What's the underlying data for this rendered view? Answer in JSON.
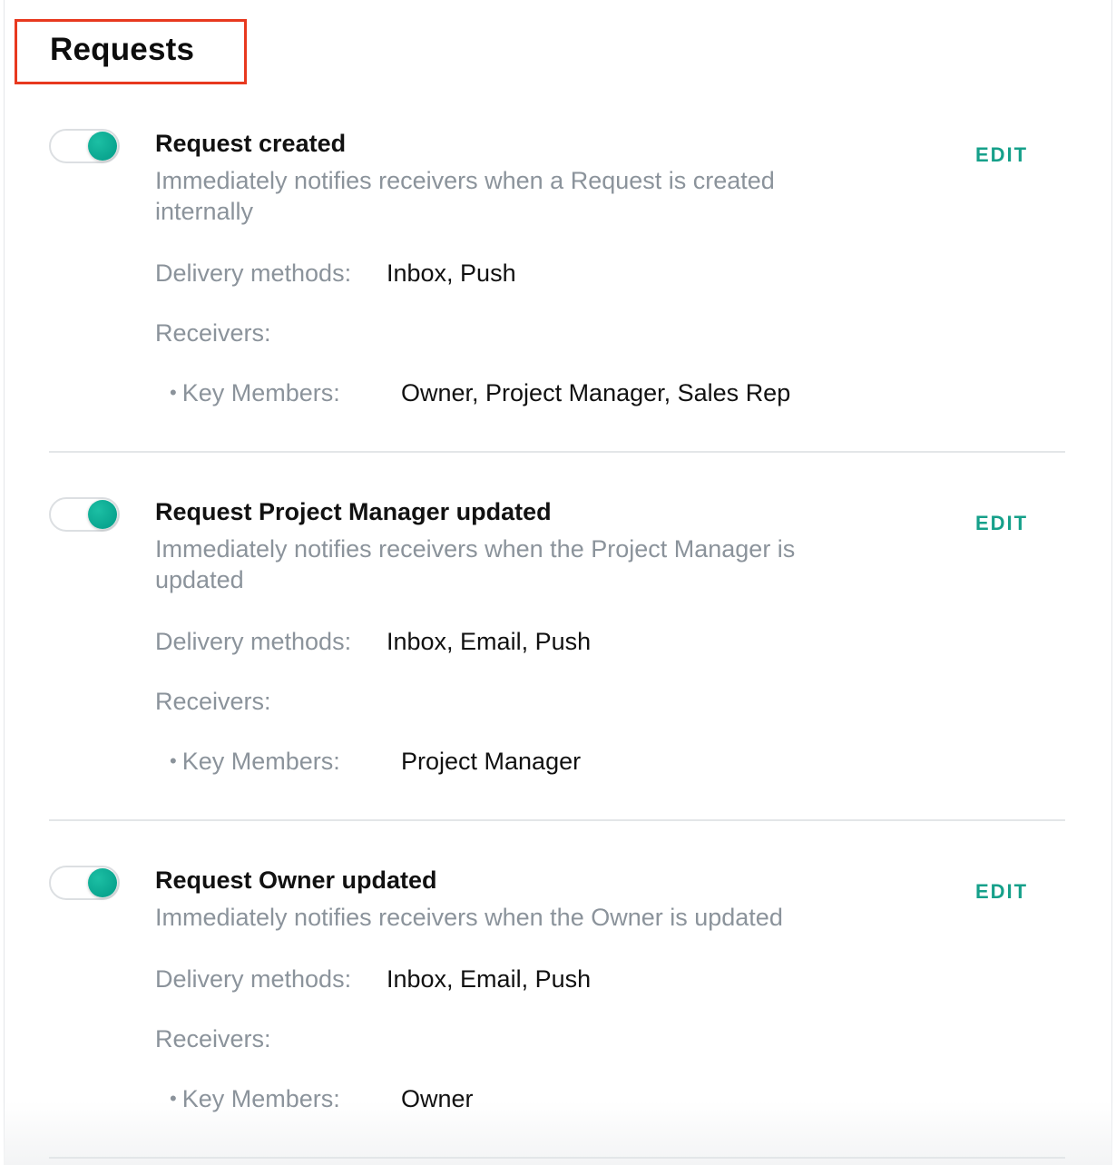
{
  "section": {
    "title": "Requests"
  },
  "labels": {
    "delivery_methods": "Delivery methods:",
    "receivers": "Receivers:",
    "key_members": "Key Members:",
    "edit": "EDIT"
  },
  "items": [
    {
      "enabled": true,
      "title": "Request created",
      "description": "Immediately notifies receivers when a Request is created internally",
      "delivery_methods": "Inbox, Push",
      "key_members": "Owner, Project Manager, Sales Rep"
    },
    {
      "enabled": true,
      "title": "Request Project Manager updated",
      "description": "Immediately notifies receivers when the Project Manager is updated",
      "delivery_methods": "Inbox, Email, Push",
      "key_members": "Project Manager"
    },
    {
      "enabled": true,
      "title": "Request Owner updated",
      "description": "Immediately notifies receivers when the Owner is updated",
      "delivery_methods": "Inbox, Email, Push",
      "key_members": "Owner"
    }
  ],
  "colors": {
    "accent": "#16a08a",
    "highlight_border": "#e8391f",
    "muted_text": "#8b939b"
  }
}
